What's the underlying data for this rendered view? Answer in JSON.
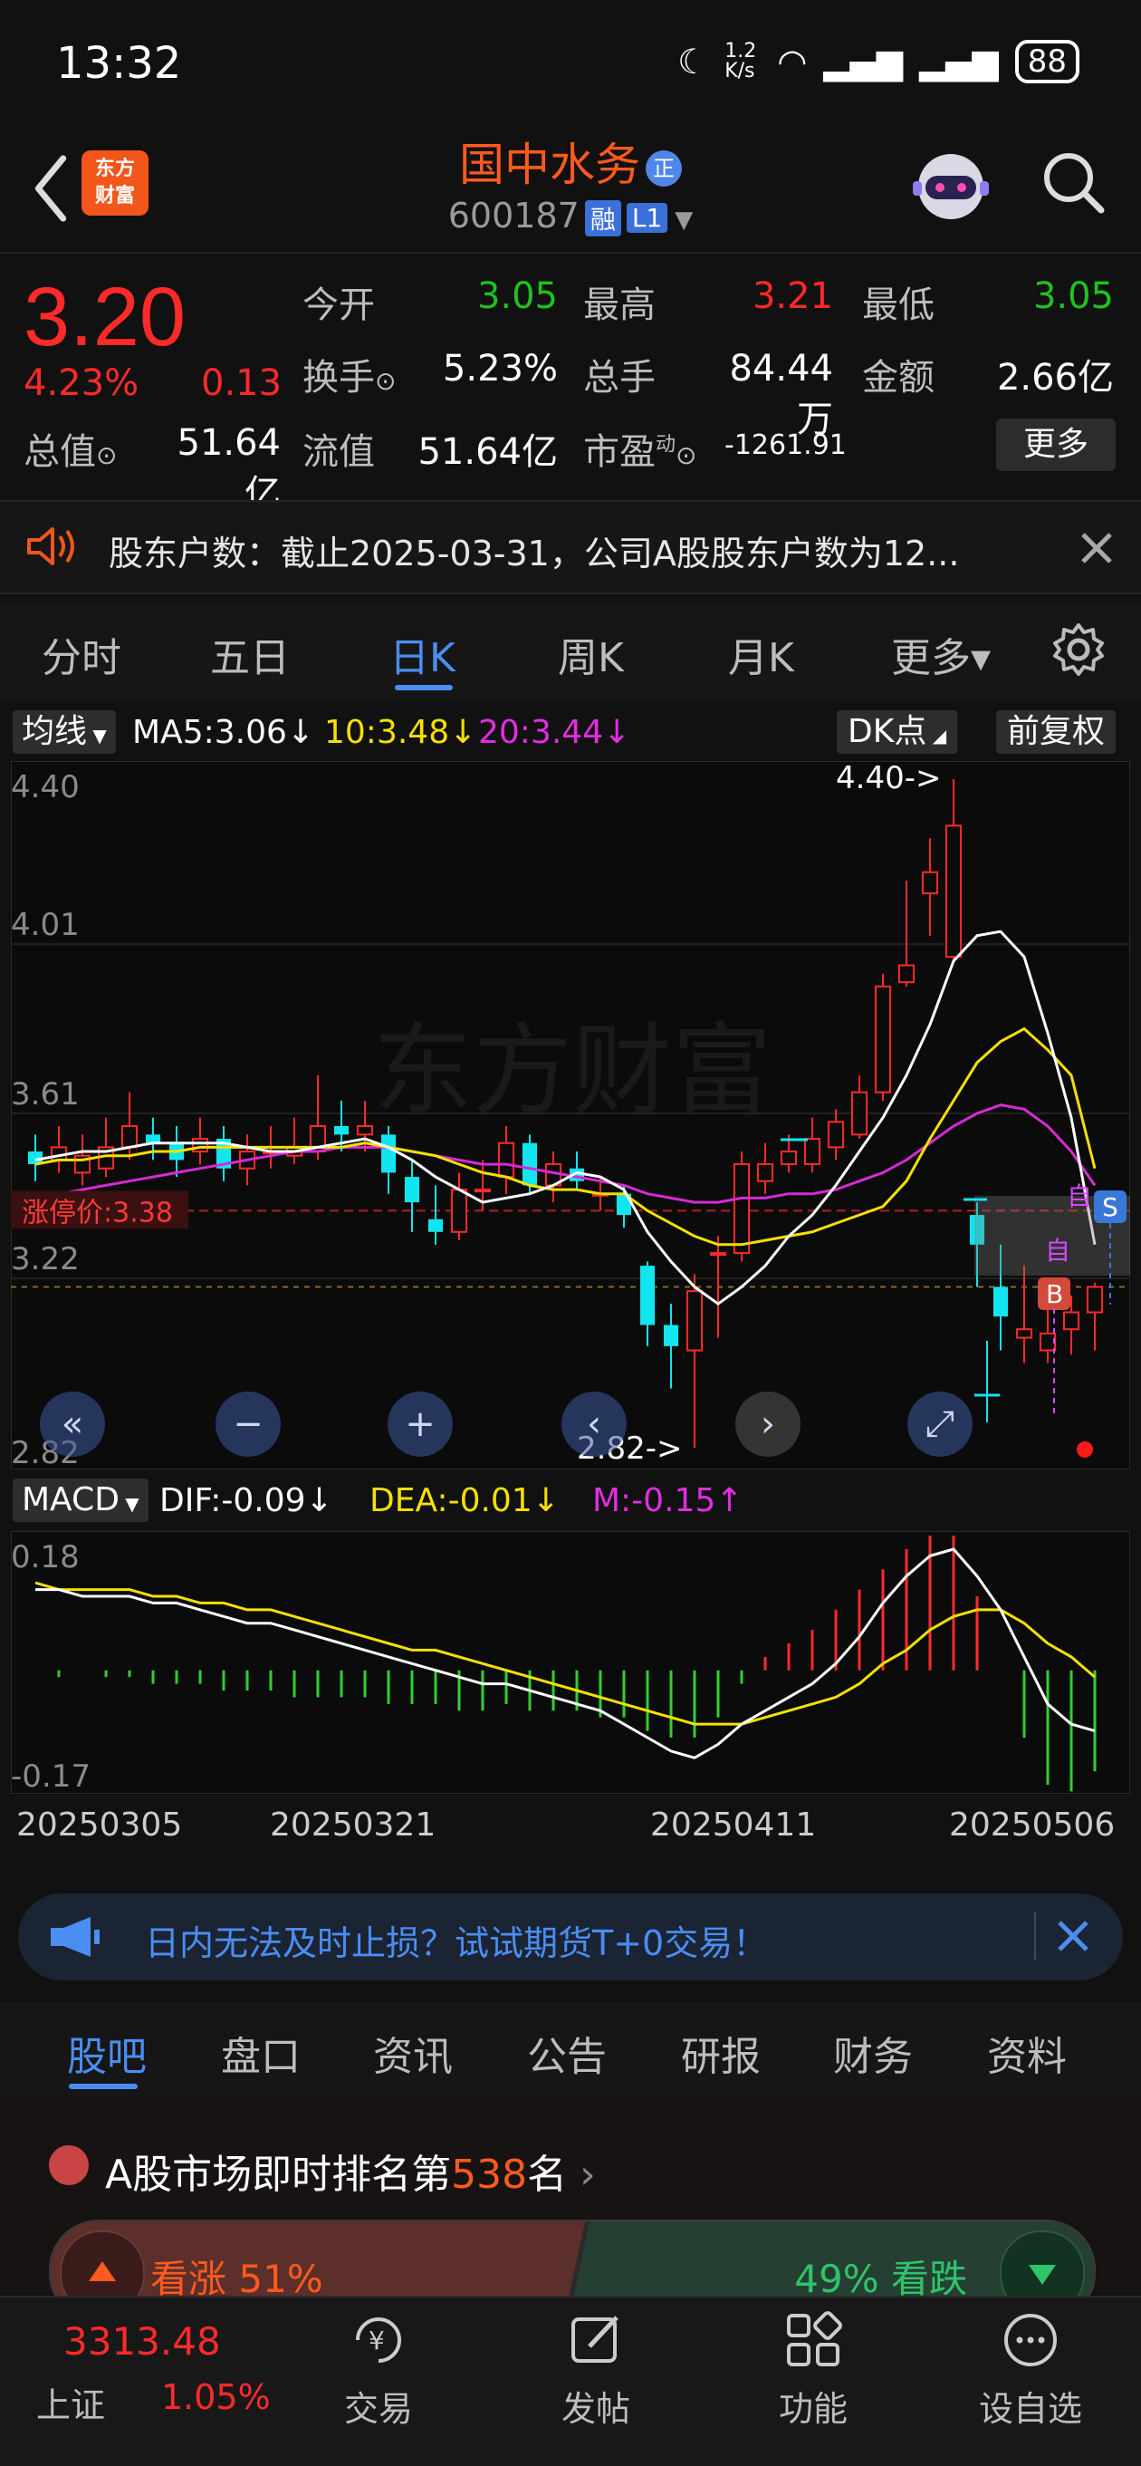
{
  "status_bar": {
    "time": "13:32",
    "net_speed": "1.2 K/s",
    "battery": "88"
  },
  "header": {
    "logo_text": [
      "东方",
      "财富"
    ],
    "stock_name": "国中水务",
    "badge": "正",
    "code": "600187",
    "tag_rong": "融",
    "tag_l1": "L1"
  },
  "quote": {
    "price": "3.20",
    "pct": "4.23%",
    "change": "0.13",
    "fields": [
      {
        "label": "今开",
        "value": "3.05",
        "color": "green"
      },
      {
        "label": "最高",
        "value": "3.21",
        "color": "red"
      },
      {
        "label": "最低",
        "value": "3.05",
        "color": "green"
      },
      {
        "label": "换手",
        "value": "5.23%",
        "color": "white"
      },
      {
        "label": "总手",
        "value": "84.44万",
        "color": "white"
      },
      {
        "label": "金额",
        "value": "2.66亿",
        "color": "white"
      },
      {
        "label": "总值",
        "value": "51.64亿",
        "color": "white"
      },
      {
        "label": "流值",
        "value": "51.64亿",
        "color": "white"
      },
      {
        "label": "市盈",
        "value": "-1261.91",
        "color": "white"
      }
    ],
    "pe_superscript": "动",
    "more_label": "更多"
  },
  "notice": {
    "text": "股东户数：截止2025-03-31，公司A股股东户数为12..."
  },
  "chart_tabs": [
    "分时",
    "五日",
    "日K",
    "周K",
    "月K",
    "更多▾"
  ],
  "chart_tab_active": "日K",
  "ma_bar": {
    "button": "均线",
    "ma5": "MA5:3.06↓",
    "ma10": "10:3.48↓",
    "ma20": "20:3.44↓",
    "dk": "DK点",
    "fq": "前复权"
  },
  "macd_bar": {
    "button": "MACD",
    "dif": "DIF:-0.09↓",
    "dea": "DEA:-0.01↓",
    "m": "M:-0.15↑"
  },
  "chart_labels": {
    "y_ticks": [
      "4.40",
      "4.01",
      "3.61",
      "3.22",
      "2.82"
    ],
    "limit_price": "涨停价:3.38",
    "high_marker": "4.40->",
    "low_marker": "2.82->",
    "macd_ticks": [
      "0.18",
      "-0.17"
    ],
    "dates": [
      "20250305",
      "20250321",
      "20250411",
      "20250506"
    ],
    "marker_b": "B",
    "marker_s": "S",
    "marker_zi": "自"
  },
  "chart_data": {
    "type": "candlestick",
    "y_range": [
      2.82,
      4.4
    ],
    "limit_up": 3.38,
    "candles": [
      [
        3.52,
        3.49,
        3.56,
        3.45
      ],
      [
        3.5,
        3.53,
        3.58,
        3.47
      ],
      [
        3.47,
        3.51,
        3.56,
        3.44
      ],
      [
        3.48,
        3.53,
        3.6,
        3.46
      ],
      [
        3.53,
        3.58,
        3.66,
        3.5
      ],
      [
        3.56,
        3.54,
        3.6,
        3.5
      ],
      [
        3.54,
        3.5,
        3.58,
        3.46
      ],
      [
        3.52,
        3.55,
        3.6,
        3.49
      ],
      [
        3.55,
        3.48,
        3.58,
        3.45
      ],
      [
        3.48,
        3.52,
        3.56,
        3.44
      ],
      [
        3.52,
        3.52,
        3.58,
        3.48
      ],
      [
        3.51,
        3.53,
        3.6,
        3.49
      ],
      [
        3.52,
        3.58,
        3.7,
        3.5
      ],
      [
        3.58,
        3.56,
        3.64,
        3.52
      ],
      [
        3.56,
        3.58,
        3.64,
        3.52
      ],
      [
        3.56,
        3.47,
        3.58,
        3.42
      ],
      [
        3.46,
        3.4,
        3.5,
        3.33
      ],
      [
        3.36,
        3.33,
        3.44,
        3.3
      ],
      [
        3.33,
        3.43,
        3.47,
        3.31
      ],
      [
        3.43,
        3.43,
        3.5,
        3.38
      ],
      [
        3.46,
        3.54,
        3.58,
        3.42
      ],
      [
        3.54,
        3.44,
        3.56,
        3.42
      ],
      [
        3.44,
        3.49,
        3.52,
        3.4
      ],
      [
        3.48,
        3.45,
        3.52,
        3.43
      ],
      [
        3.42,
        3.42,
        3.46,
        3.38
      ],
      [
        3.42,
        3.37,
        3.44,
        3.34
      ],
      [
        3.25,
        3.11,
        3.26,
        3.06
      ],
      [
        3.11,
        3.06,
        3.16,
        2.96
      ],
      [
        3.05,
        3.19,
        3.23,
        2.82
      ],
      [
        3.28,
        3.28,
        3.32,
        3.08
      ],
      [
        3.28,
        3.49,
        3.52,
        3.26
      ],
      [
        3.45,
        3.49,
        3.54,
        3.42
      ],
      [
        3.49,
        3.52,
        3.56,
        3.47
      ],
      [
        3.49,
        3.55,
        3.6,
        3.47
      ],
      [
        3.53,
        3.59,
        3.62,
        3.5
      ],
      [
        3.56,
        3.66,
        3.7,
        3.55
      ],
      [
        3.66,
        3.91,
        3.94,
        3.64
      ],
      [
        3.92,
        3.96,
        4.16,
        3.91
      ],
      [
        4.13,
        4.18,
        4.26,
        4.03
      ],
      [
        3.98,
        4.29,
        4.4,
        3.97
      ],
      [
        3.37,
        3.3,
        3.4,
        3.2
      ],
      [
        3.2,
        3.13,
        3.3,
        3.05
      ],
      [
        3.08,
        3.1,
        3.25,
        3.02
      ],
      [
        3.05,
        3.09,
        3.16,
        3.02
      ],
      [
        3.1,
        3.14,
        3.18,
        3.04
      ],
      [
        3.14,
        3.2,
        3.21,
        3.05
      ]
    ],
    "ma5": [
      3.5,
      3.51,
      3.52,
      3.52,
      3.53,
      3.54,
      3.54,
      3.54,
      3.54,
      3.53,
      3.52,
      3.52,
      3.53,
      3.54,
      3.55,
      3.53,
      3.5,
      3.46,
      3.43,
      3.4,
      3.41,
      3.42,
      3.44,
      3.47,
      3.46,
      3.43,
      3.33,
      3.26,
      3.2,
      3.16,
      3.2,
      3.25,
      3.32,
      3.37,
      3.44,
      3.52,
      3.6,
      3.7,
      3.82,
      3.97,
      4.03,
      4.04,
      3.98,
      3.8,
      3.6,
      3.3
    ],
    "ma10": [
      3.49,
      3.5,
      3.5,
      3.51,
      3.51,
      3.52,
      3.52,
      3.53,
      3.53,
      3.53,
      3.53,
      3.53,
      3.53,
      3.53,
      3.54,
      3.53,
      3.52,
      3.51,
      3.49,
      3.47,
      3.46,
      3.44,
      3.43,
      3.43,
      3.42,
      3.42,
      3.38,
      3.35,
      3.32,
      3.3,
      3.3,
      3.31,
      3.32,
      3.33,
      3.35,
      3.37,
      3.39,
      3.45,
      3.55,
      3.64,
      3.73,
      3.78,
      3.81,
      3.76,
      3.7,
      3.48
    ],
    "ma20": [
      3.41,
      3.42,
      3.43,
      3.44,
      3.45,
      3.46,
      3.47,
      3.48,
      3.49,
      3.5,
      3.51,
      3.52,
      3.52,
      3.53,
      3.53,
      3.53,
      3.52,
      3.51,
      3.5,
      3.49,
      3.49,
      3.48,
      3.47,
      3.46,
      3.45,
      3.44,
      3.42,
      3.41,
      3.4,
      3.4,
      3.41,
      3.41,
      3.42,
      3.42,
      3.43,
      3.45,
      3.47,
      3.5,
      3.54,
      3.58,
      3.61,
      3.63,
      3.62,
      3.58,
      3.52,
      3.44
    ],
    "macd_range": [
      -0.17,
      0.18
    ],
    "dif": [
      0.12,
      0.12,
      0.11,
      0.11,
      0.11,
      0.1,
      0.1,
      0.09,
      0.08,
      0.07,
      0.07,
      0.06,
      0.05,
      0.04,
      0.03,
      0.02,
      0.01,
      0.0,
      -0.01,
      -0.02,
      -0.02,
      -0.03,
      -0.04,
      -0.05,
      -0.06,
      -0.08,
      -0.1,
      -0.12,
      -0.13,
      -0.11,
      -0.08,
      -0.06,
      -0.04,
      -0.02,
      0.01,
      0.05,
      0.1,
      0.14,
      0.17,
      0.18,
      0.14,
      0.09,
      0.02,
      -0.05,
      -0.08,
      -0.09
    ],
    "dea": [
      0.13,
      0.12,
      0.12,
      0.12,
      0.12,
      0.11,
      0.11,
      0.1,
      0.1,
      0.09,
      0.09,
      0.08,
      0.07,
      0.06,
      0.05,
      0.04,
      0.03,
      0.03,
      0.02,
      0.01,
      0.0,
      -0.01,
      -0.02,
      -0.03,
      -0.04,
      -0.05,
      -0.06,
      -0.07,
      -0.08,
      -0.08,
      -0.08,
      -0.07,
      -0.06,
      -0.05,
      -0.04,
      -0.02,
      0.01,
      0.03,
      0.06,
      0.08,
      0.09,
      0.09,
      0.07,
      0.04,
      0.02,
      -0.01
    ],
    "macd": [
      0.0,
      -0.01,
      0.0,
      -0.01,
      -0.01,
      -0.02,
      -0.02,
      -0.02,
      -0.03,
      -0.03,
      -0.03,
      -0.04,
      -0.04,
      -0.04,
      -0.04,
      -0.05,
      -0.05,
      -0.05,
      -0.06,
      -0.06,
      -0.05,
      -0.06,
      -0.06,
      -0.06,
      -0.07,
      -0.07,
      -0.09,
      -0.1,
      -0.1,
      -0.07,
      -0.02,
      0.02,
      0.04,
      0.06,
      0.09,
      0.12,
      0.15,
      0.18,
      0.2,
      0.2,
      0.11,
      0.0,
      -0.1,
      -0.17,
      -0.18,
      -0.15
    ]
  },
  "ad": {
    "text": "日内无法及时止损？试试期货T+0交易！"
  },
  "info_tabs": [
    "股吧",
    "盘口",
    "资讯",
    "公告",
    "研报",
    "财务",
    "资料"
  ],
  "rank": {
    "prefix": "A股市场即时排名第",
    "num": "538",
    "suffix": "名"
  },
  "vote": {
    "up": "看涨 51%",
    "down": "49% 看跌"
  },
  "index": {
    "value": "3313.48",
    "name": "上证",
    "pct": "1.05%"
  },
  "nav": [
    {
      "label": "交易",
      "icon": "trade-icon"
    },
    {
      "label": "发帖",
      "icon": "post-icon"
    },
    {
      "label": "功能",
      "icon": "grid-icon"
    },
    {
      "label": "设自选",
      "icon": "more-icon"
    }
  ],
  "colors": {
    "up": "#ff2a2a",
    "down": "#1ec31e",
    "accent": "#4b8ef3",
    "brand": "#f3561a"
  }
}
